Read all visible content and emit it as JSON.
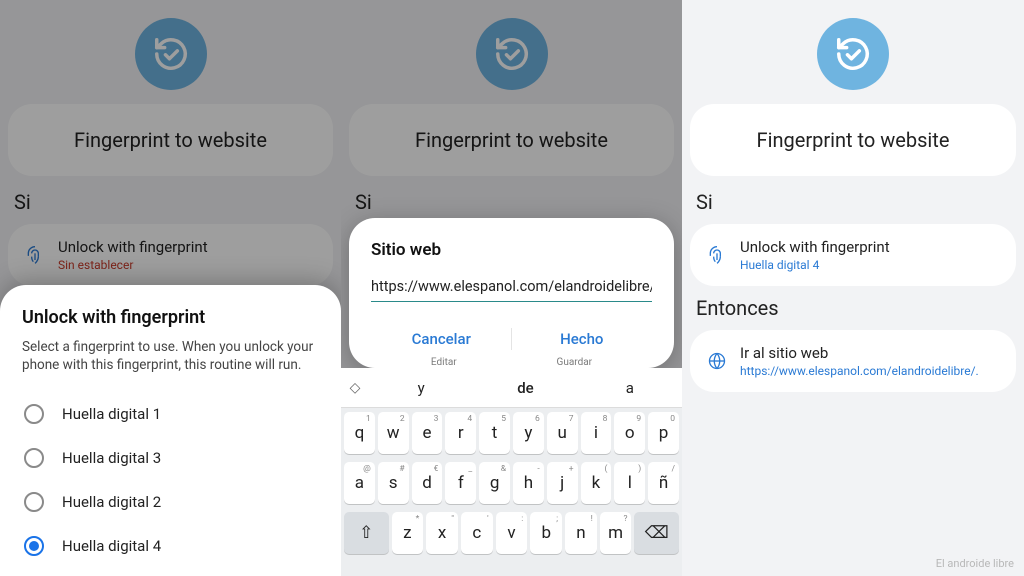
{
  "common": {
    "header_title": "Fingerprint to website",
    "si_label": "Si",
    "unlock_title": "Unlock with fingerprint"
  },
  "panel1": {
    "sub_unset": "Sin establecer",
    "sheet_title": "Unlock with fingerprint",
    "sheet_desc": "Select a fingerprint to use. When you unlock your phone with this fingerprint, this routine will run.",
    "options": [
      "Huella digital 1",
      "Huella digital 3",
      "Huella digital 2",
      "Huella digital 4"
    ],
    "selected_index": 3
  },
  "panel2": {
    "dialog_title": "Sitio web",
    "url": "https://www.elespanol.com/elandroidelibre/",
    "cancel": "Cancelar",
    "done": "Hecho",
    "ghost_left": "Editar",
    "ghost_right": "Guardar",
    "suggestions": [
      "y",
      "de",
      "a"
    ],
    "keys_row1": [
      [
        "q",
        "1"
      ],
      [
        "w",
        "2"
      ],
      [
        "e",
        "3"
      ],
      [
        "r",
        "4"
      ],
      [
        "t",
        "5"
      ],
      [
        "y",
        "6"
      ],
      [
        "u",
        "7"
      ],
      [
        "i",
        "8"
      ],
      [
        "o",
        "9"
      ],
      [
        "p",
        "0"
      ]
    ],
    "keys_row2": [
      [
        "a",
        "@"
      ],
      [
        "s",
        "#"
      ],
      [
        "d",
        "€"
      ],
      [
        "f",
        "_"
      ],
      [
        "g",
        "&"
      ],
      [
        "h",
        "-"
      ],
      [
        "j",
        "+"
      ],
      [
        "k",
        "("
      ],
      [
        "l",
        ")"
      ],
      [
        "ñ",
        "/"
      ]
    ],
    "keys_row3": [
      [
        "z",
        "*"
      ],
      [
        "x",
        "\""
      ],
      [
        "c",
        "'"
      ],
      [
        "v",
        ":"
      ],
      [
        "b",
        ";"
      ],
      [
        "n",
        "!"
      ],
      [
        "m",
        "?"
      ]
    ]
  },
  "panel3": {
    "sub_set": "Huella digital 4",
    "then_label": "Entonces",
    "goto_title": "Ir al sitio web",
    "goto_sub": "https://www.elespanol.com/elandroidelibre/.",
    "watermark": "El androide libre"
  }
}
